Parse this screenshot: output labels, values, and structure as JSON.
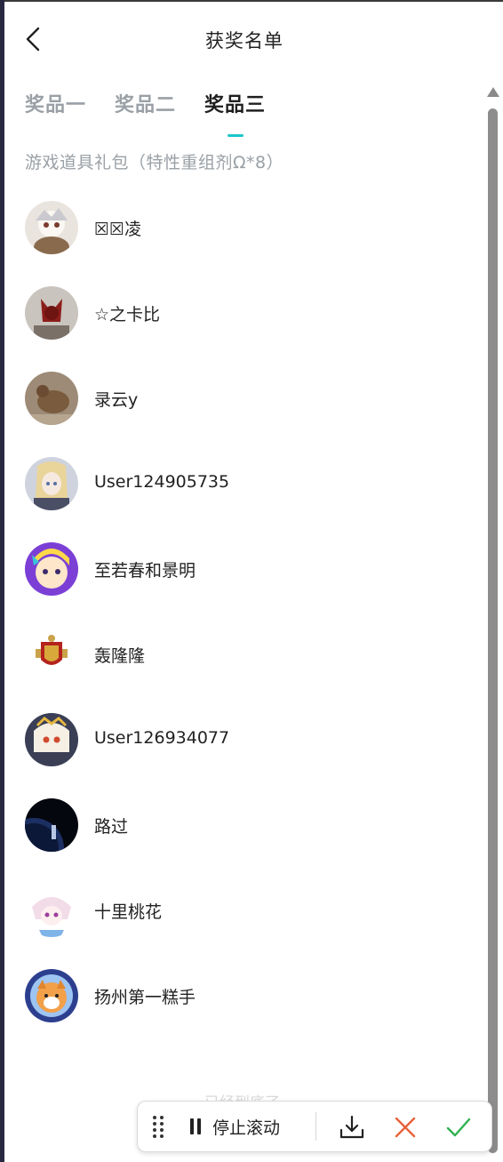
{
  "header": {
    "title": "获奖名单",
    "back_icon": "chevron-left-icon"
  },
  "tabs": [
    {
      "label": "奖品一",
      "active": false
    },
    {
      "label": "奖品二",
      "active": false
    },
    {
      "label": "奖品三",
      "active": true
    }
  ],
  "prize_name": "游戏道具礼包（特性重组剂Ω*8）",
  "winners": [
    {
      "name": "☒☒凌"
    },
    {
      "name": "☆之卡比"
    },
    {
      "name": "录云y"
    },
    {
      "name": "User124905735"
    },
    {
      "name": "至若春和景明"
    },
    {
      "name": "轰隆隆"
    },
    {
      "name": "User126934077"
    },
    {
      "name": "路过"
    },
    {
      "name": "十里桃花"
    },
    {
      "name": "扬州第一糕手"
    }
  ],
  "end_text": "已经到底了",
  "toolbar": {
    "stop_scroll_label": "停止滚动",
    "icons": [
      "drag-handle-icon",
      "pause-icon",
      "download-icon",
      "close-icon",
      "check-icon"
    ]
  },
  "colors": {
    "accent": "#1bc6c9",
    "cancel": "#e8623a",
    "confirm": "#2fb24f",
    "muted": "#9aa0a6"
  }
}
